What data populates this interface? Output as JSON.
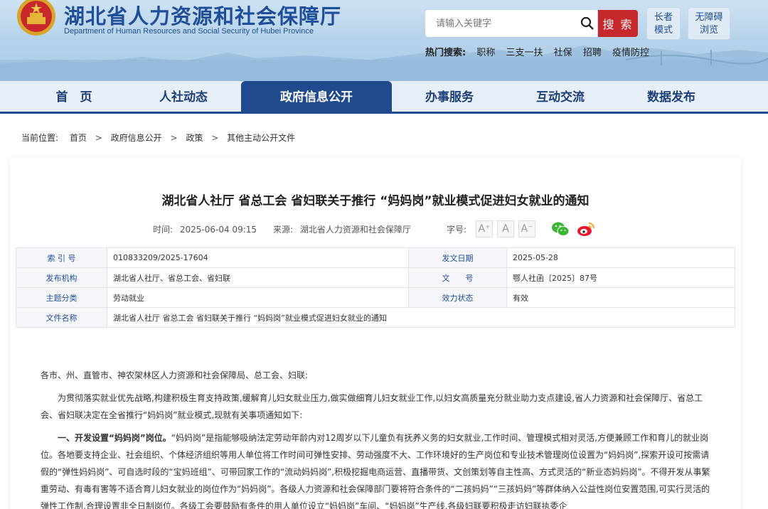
{
  "header": {
    "title_cn": "湖北省人力资源和社会保障厅",
    "title_en": "Department of Human Resources and Social Security of Hubei Province",
    "search_placeholder": "请输入关键字",
    "search_button": "搜 索",
    "elder_mode": [
      "长者",
      "模式"
    ],
    "barrier_free": [
      "无障碍",
      "浏览"
    ],
    "hot_label": "热门搜索:",
    "hot_items": [
      "职称",
      "三支一扶",
      "社保",
      "招聘",
      "疫情防控"
    ]
  },
  "nav": {
    "items": [
      "首　页",
      "人社动态",
      "政府信息公开",
      "办事服务",
      "互动交流",
      "数据发布"
    ],
    "active_index": 2
  },
  "breadcrumb": {
    "label": "当前位置:",
    "items": [
      "首页",
      "政府信息公开",
      "政策",
      "其他主动公开文件"
    ],
    "separator": ">"
  },
  "article": {
    "title": "湖北省人社厅 省总工会 省妇联关于推行 “妈妈岗”就业模式促进妇女就业的通知",
    "time_label": "时间:",
    "time": "2025-06-04 09:15",
    "source_label": "来源:",
    "source": "湖北省人力资源和社会保障厅",
    "fontsize_label": "字号:",
    "font_sizes": [
      "A⁺",
      "A",
      "A⁻"
    ],
    "info": {
      "index_no_label": "索 引 号",
      "index_no": "010833209/2025-17604",
      "date_label": "发文日期",
      "date": "2025-05-28",
      "issuer_label": "发布机构",
      "issuer": "湖北省人社厅、省总工会、省妇联",
      "doc_no_label": "文　　号",
      "doc_no": "鄂人社函〔2025〕87号",
      "topic_label": "主题分类",
      "topic": "劳动就业",
      "status_label": "效力状态",
      "status": "有效",
      "filename_label": "文件名称",
      "filename": "湖北省人社厅 省总工会 省妇联关于推行 “妈妈岗”就业模式促进妇女就业的通知"
    },
    "salutation": "各市、州、直管市、神农架林区人力资源和社会保障局、总工会、妇联:",
    "para1": "为贯彻落实就业优先战略,构建积极生育支持政策,缓解育儿妇女就业压力,做实做细育儿妇女就业工作,以妇女高质量充分就业助力支点建设,省人力资源和社会保障厅、省总工会、省妇联决定在全省推行“妈妈岗”就业模式,现就有关事项通知如下:",
    "para2_heading": "一、开发设置“妈妈岗”岗位。",
    "para2": "“妈妈岗”是指能够吸纳法定劳动年龄内对12周岁以下儿童负有抚养义务的妇女就业,工作时间、管理模式相对灵活,方便兼顾工作和育儿的就业岗位。各地要支持企业、社会组织、个体经济组织等用人单位将工作时间可弹性安排、劳动强度不大、工作环境好的生产岗位和专业技术管理岗位设置为“妈妈岗”,探索开设可按需请假的“弹性妈妈岗”、可自选时段的“宝妈班组”、可带回家工作的“流动妈妈岗”,积极挖掘电商运营、直播带货、文创策划等自主性高、方式灵活的“新业态妈妈岗”。不得开发从事繁重劳动、有毒有害等不适合育儿妇女就业的岗位作为“妈妈岗”。各级人力资源和社会保障部门要将符合条件的“二孩妈妈”“三孩妈妈”等群体纳入公益性岗位安置范围,可实行灵活的弹性工作制,合理设置非全日制岗位。各级工会要鼓励有条件的用人单位设立“妈妈岗”车间、“妈妈岗”生产线,各级妇联要积极走访妇联执委企"
  }
}
